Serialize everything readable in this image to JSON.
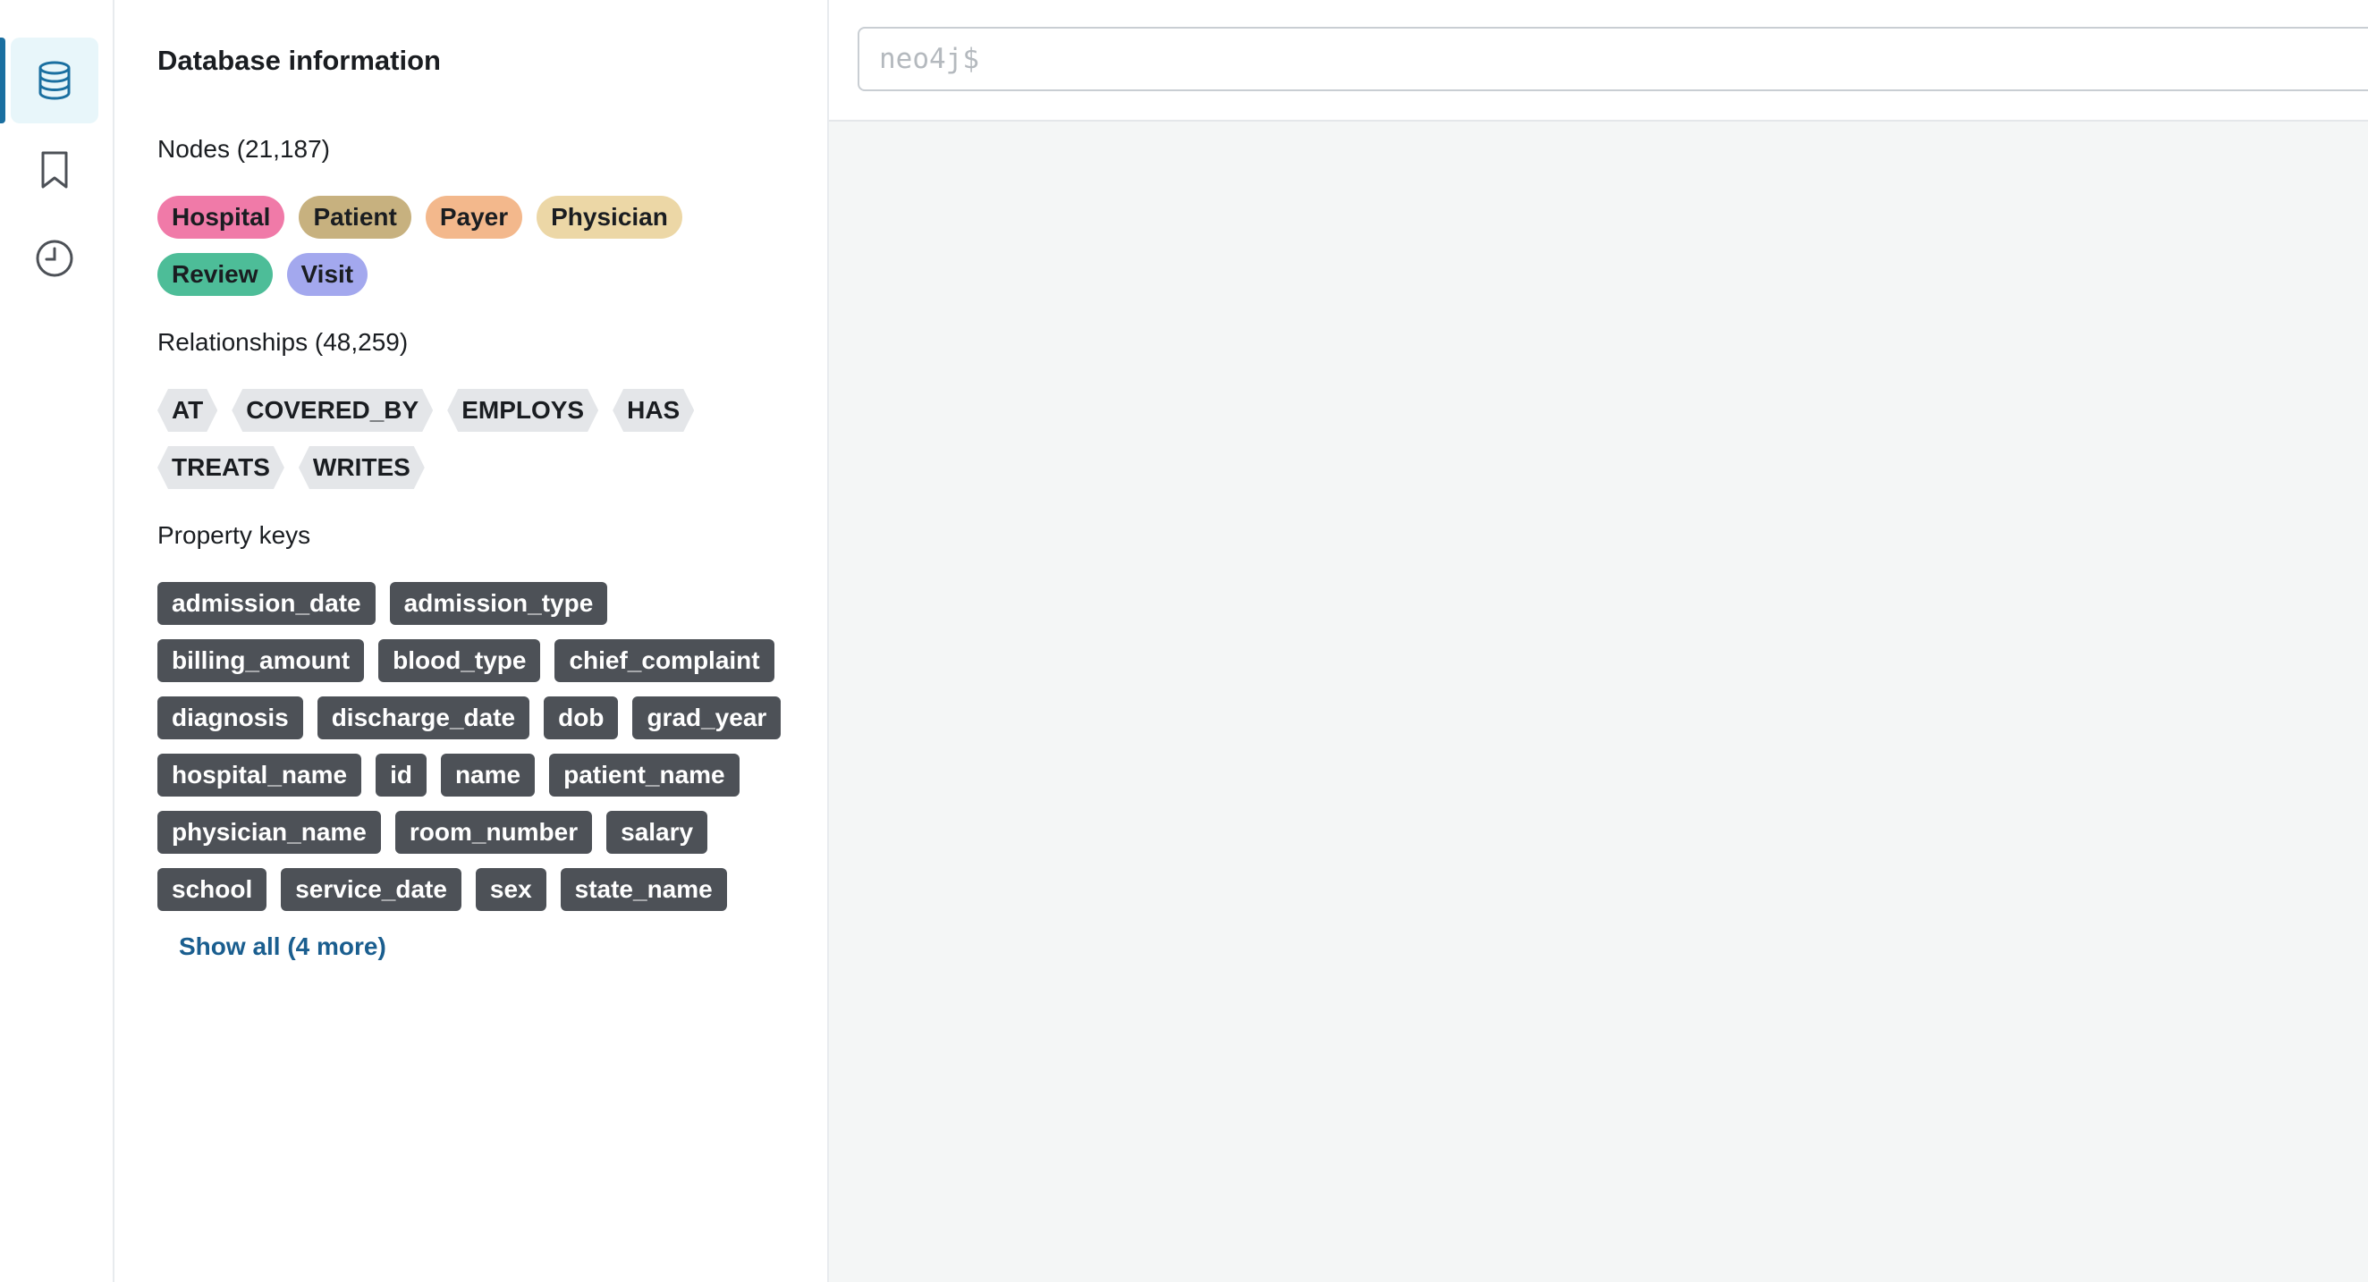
{
  "drawer": {
    "title": "Database information",
    "nodes_title": "Nodes (21,187)",
    "relationships_title": "Relationships (48,259)",
    "property_keys_title": "Property keys",
    "show_all": "Show all (4 more)"
  },
  "node_labels": [
    {
      "label": "Hospital",
      "color": "#f07aa8"
    },
    {
      "label": "Patient",
      "color": "#c7b17f"
    },
    {
      "label": "Payer",
      "color": "#f3b88c"
    },
    {
      "label": "Physician",
      "color": "#ecd7a6"
    },
    {
      "label": "Review",
      "color": "#4dbd98"
    },
    {
      "label": "Visit",
      "color": "#a3a8ee"
    }
  ],
  "relationship_types": [
    "AT",
    "COVERED_BY",
    "EMPLOYS",
    "HAS",
    "TREATS",
    "WRITES"
  ],
  "property_keys": [
    "admission_date",
    "admission_type",
    "billing_amount",
    "blood_type",
    "chief_complaint",
    "diagnosis",
    "discharge_date",
    "dob",
    "grad_year",
    "hospital_name",
    "id",
    "name",
    "patient_name",
    "physician_name",
    "room_number",
    "salary",
    "school",
    "service_date",
    "sex",
    "state_name"
  ],
  "editor": {
    "placeholder": "neo4j$"
  },
  "icons": {
    "rail_database": "database-icon",
    "rail_favorites": "bookmark-icon",
    "rail_history": "clock-icon"
  },
  "colors": {
    "accent": "#1a6fa0",
    "rail_active_bg": "#e8f6fa",
    "prop_tag_bg": "#4d5157",
    "rel_tag_bg": "#e4e6e9",
    "link": "#1a5e8f"
  }
}
